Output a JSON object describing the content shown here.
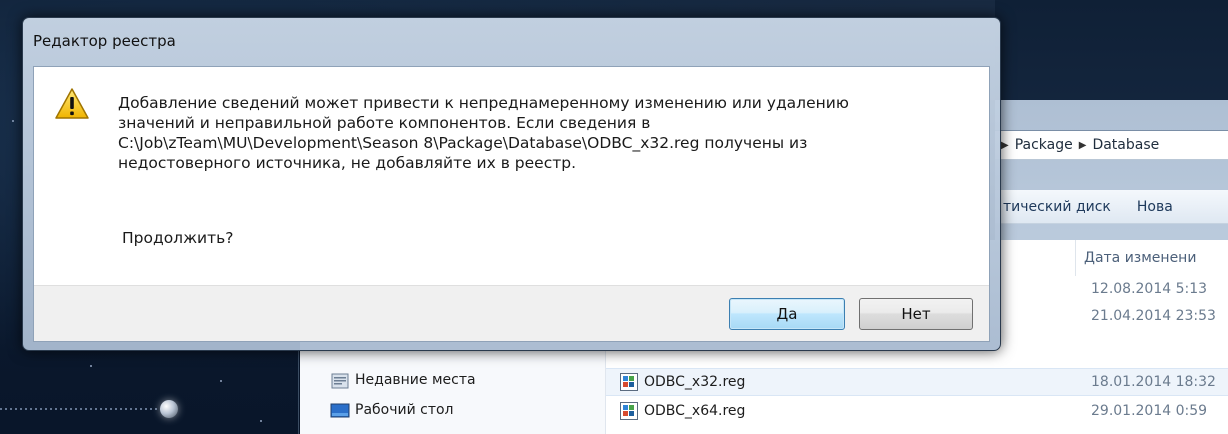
{
  "dialog": {
    "title": "Редактор реестра",
    "message_lines": [
      "Добавление сведений может привести к непреднамеренному изменению или удалению",
      "значений и неправильной работе компонентов. Если сведения в",
      "C:\\Job\\zTeam\\MU\\Development\\Season 8\\Package\\Database\\ODBC_x32.reg получены из",
      "недостоверного источника, не добавляйте их в реестр."
    ],
    "prompt": "Продолжить?",
    "yes_label": "Да",
    "no_label": "Нет",
    "icon": "warning-icon"
  },
  "explorer": {
    "breadcrumb": [
      "Package",
      "Database"
    ],
    "toolbar": [
      "тический диск",
      "Нова"
    ],
    "column_date": "Дата изменени",
    "sidebar": [
      {
        "label": "Недавние места",
        "icon": "recent-places-icon"
      },
      {
        "label": "Рабочий стол",
        "icon": "desktop-icon"
      }
    ],
    "rows": [
      {
        "name": "",
        "date": "12.08.2014 5:13"
      },
      {
        "name": "",
        "date": "21.04.2014 23:53"
      },
      {
        "name": "ODBC_x32.reg",
        "date": "18.01.2014 18:32",
        "selected": true
      },
      {
        "name": "ODBC_x64.reg",
        "date": "29.01.2014 0:59"
      }
    ]
  },
  "colors": {
    "default_button_border": "#3c7fb1",
    "warning_yellow": "#f5c400"
  }
}
